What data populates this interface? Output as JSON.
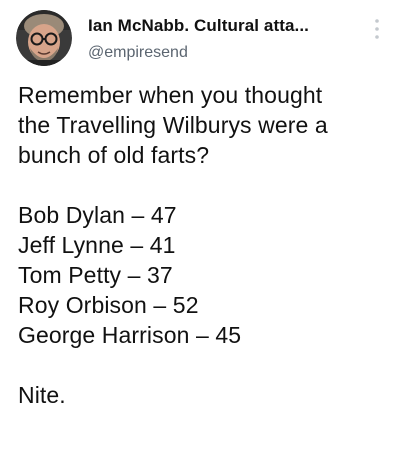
{
  "tweet": {
    "author": {
      "display_name": "Ian McNabb. Cultural atta...",
      "handle": "@empiresend",
      "avatar_icon": "avatar-photo"
    },
    "menu_icon": "more-vertical-icon",
    "intro_lines": [
      "Remember when you thought",
      "the Travelling Wilburys were a",
      "bunch of old farts?"
    ],
    "list_lines": [
      "Bob Dylan – 47",
      "Jeff Lynne – 41",
      "Tom Petty – 37",
      "Roy Orbison – 52",
      "George Harrison – 45"
    ],
    "sign_off": "Nite."
  }
}
